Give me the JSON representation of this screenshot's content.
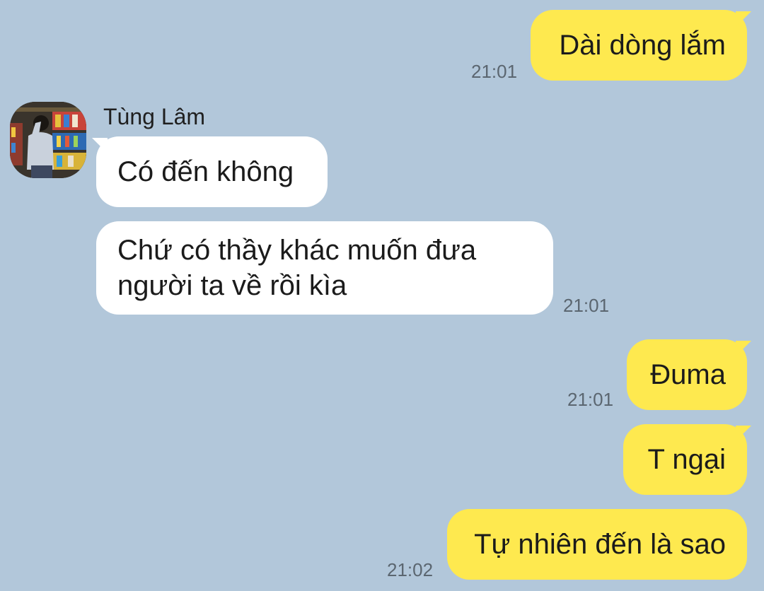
{
  "chat": {
    "contact": {
      "name": "Tùng Lâm",
      "avatar_icon": "profile-photo"
    },
    "messages": [
      {
        "from": "me",
        "text": "Dài dòng lắm",
        "time": "21:01"
      },
      {
        "from": "them",
        "text": "Có đến không",
        "time": ""
      },
      {
        "from": "them",
        "text": "Chứ có thầy khác muốn đưa người ta về rồi kìa",
        "line1": "Chứ có thầy khác muốn đưa",
        "line2": "người ta về rồi kìa",
        "time": "21:01"
      },
      {
        "from": "me",
        "text": "Đuma",
        "time": "21:01"
      },
      {
        "from": "me",
        "text": "T ngại",
        "time": ""
      },
      {
        "from": "me",
        "text": "Tự nhiên đến là sao",
        "time": "21:02"
      }
    ]
  },
  "colors": {
    "background": "#b2c7da",
    "my_bubble": "#fee94f",
    "their_bubble": "#ffffff",
    "timestamp": "#5b6670"
  }
}
